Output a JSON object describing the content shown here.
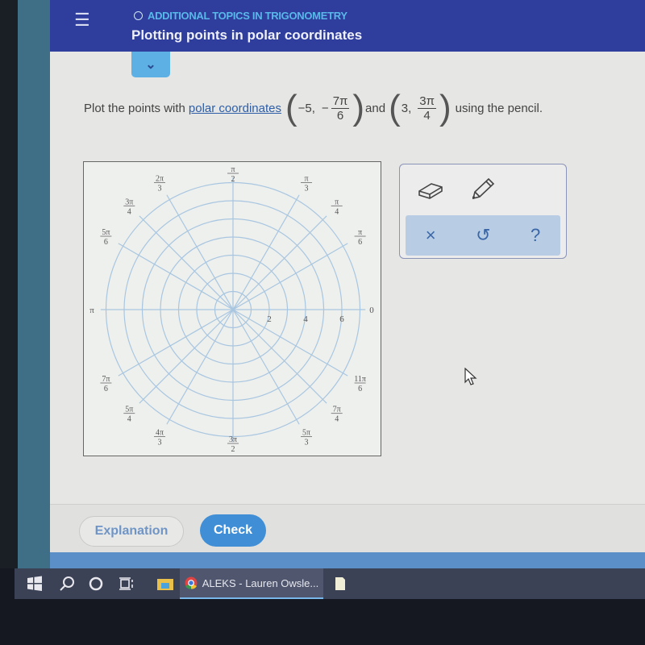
{
  "header": {
    "menu_icon": "hamburger-icon",
    "topic": "ADDITIONAL TOPICS IN TRIGONOMETRY",
    "title": "Plotting points in polar coordinates",
    "expand_icon": "chevron-down-icon"
  },
  "question": {
    "prefix": "Plot the points with",
    "link": "polar coordinates",
    "p1_r": "−5,",
    "p1_sign": "−",
    "p1_num": "7π",
    "p1_den": "6",
    "and": "and",
    "p2_r": "3,",
    "p2_num": "3π",
    "p2_den": "4",
    "suffix": "using the pencil."
  },
  "graph": {
    "type": "polar-grid",
    "rings": [
      1,
      2,
      3,
      4,
      5,
      6,
      7
    ],
    "radial_labels": [
      "2",
      "4",
      "6"
    ],
    "angle_labels": [
      {
        "n": "",
        "d": "",
        "t": "0",
        "a": 0
      },
      {
        "n": "π",
        "d": "6",
        "a": 30
      },
      {
        "n": "π",
        "d": "4",
        "a": 45
      },
      {
        "n": "π",
        "d": "3",
        "a": 60
      },
      {
        "n": "π",
        "d": "2",
        "a": 90
      },
      {
        "n": "2π",
        "d": "3",
        "a": 120
      },
      {
        "n": "3π",
        "d": "4",
        "a": 135
      },
      {
        "n": "5π",
        "d": "6",
        "a": 150
      },
      {
        "n": "",
        "d": "",
        "t": "π",
        "a": 180
      },
      {
        "n": "7π",
        "d": "6",
        "a": 210
      },
      {
        "n": "5π",
        "d": "4",
        "a": 225
      },
      {
        "n": "4π",
        "d": "3",
        "a": 240
      },
      {
        "n": "3π",
        "d": "2",
        "a": 270
      },
      {
        "n": "5π",
        "d": "3",
        "a": 300
      },
      {
        "n": "7π",
        "d": "4",
        "a": 315
      },
      {
        "n": "11π",
        "d": "6",
        "a": 330
      }
    ],
    "grid_color": "#a9c6e0"
  },
  "tools": {
    "eraser": "eraser-icon",
    "pencil": "pencil-icon",
    "clear": "×",
    "undo": "↺",
    "help": "?"
  },
  "footer": {
    "explanation": "Explanation",
    "check": "Check"
  },
  "taskbar": {
    "chrome_title": "ALEKS - Lauren Owsle..."
  }
}
